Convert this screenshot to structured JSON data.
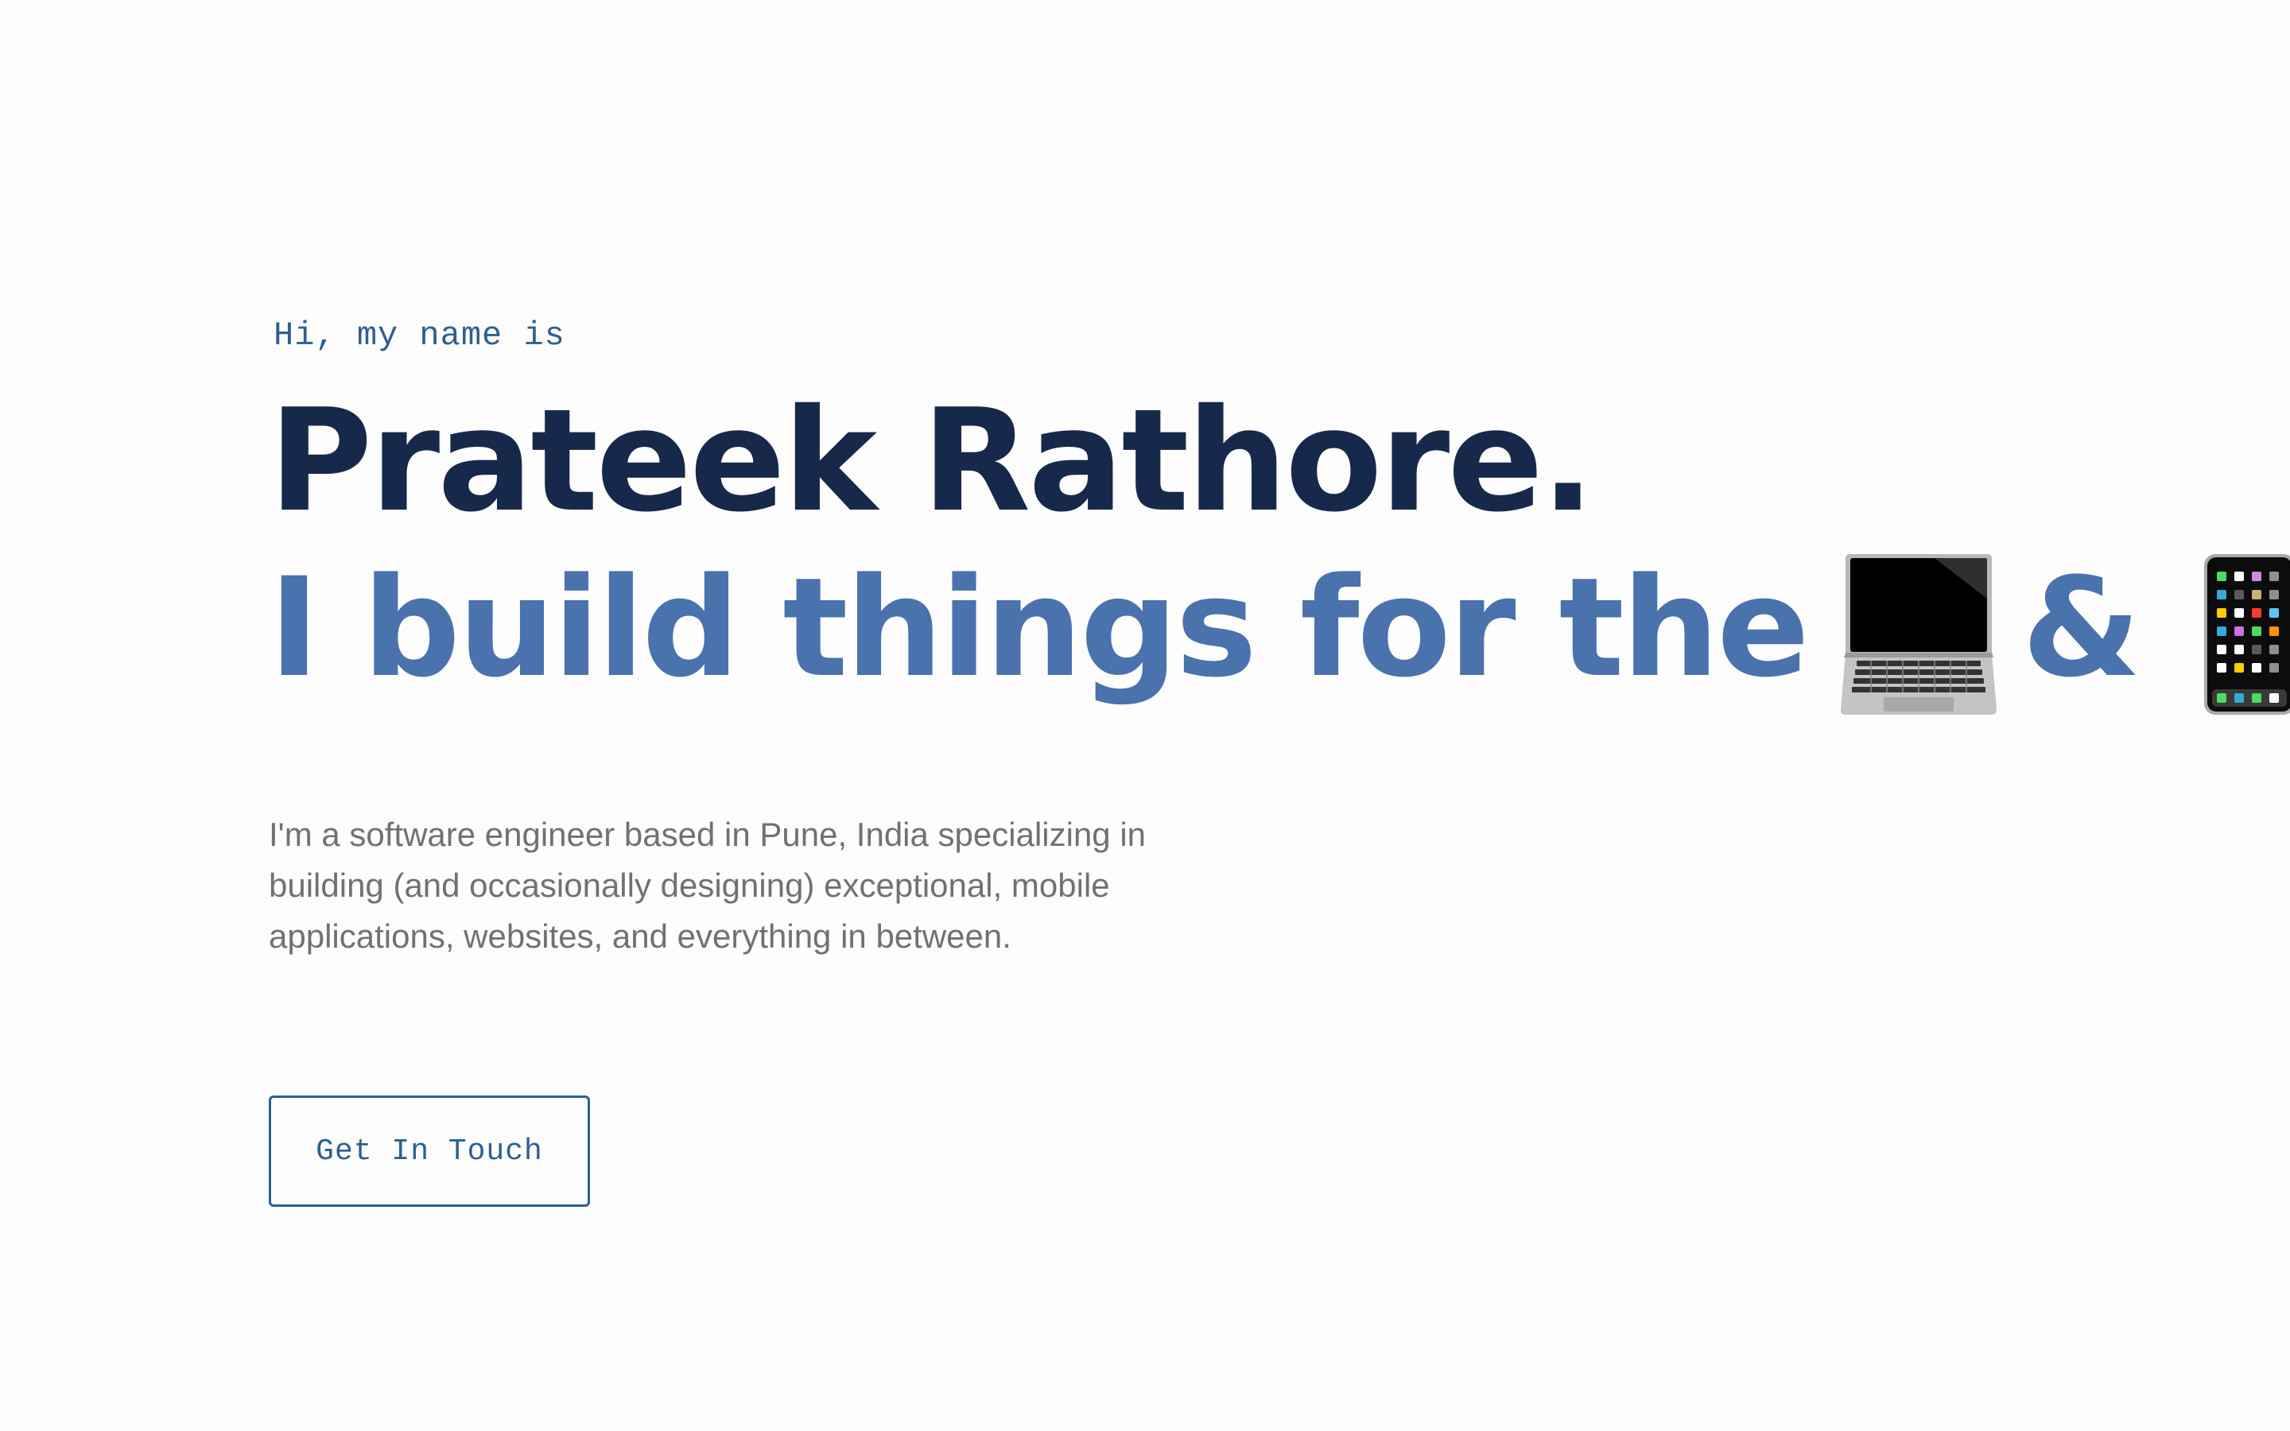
{
  "hero": {
    "greeting": "Hi, my name is",
    "name": "Prateek Rathore.",
    "tagline": {
      "text": "I build things for the",
      "icon_1": "laptop-icon",
      "ampersand": "&",
      "icon_2": "mobile-phone-icon"
    },
    "bio": "I'm a software engineer based in Pune, India specializing in building (and occasionally designing) exceptional, mobile applications, websites, and everything in between.",
    "cta_label": "Get In Touch"
  },
  "colors": {
    "background": "#fdfdfd",
    "name": "#17294a",
    "tagline": "#4a72ac",
    "accent": "#2f5f8f",
    "body_text": "#717171"
  }
}
